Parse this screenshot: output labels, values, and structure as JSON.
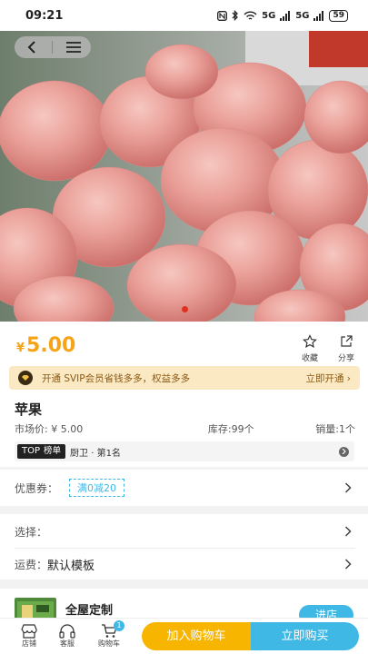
{
  "status_bar": {
    "time": "09:21",
    "network": "5G",
    "battery": "59"
  },
  "hero": {
    "alt": "苹果商品图",
    "active_slide": 1
  },
  "product": {
    "currency": "¥",
    "price": "5.00",
    "favorite_label": "收藏",
    "share_label": "分享",
    "name": "苹果",
    "market_price": "市场价: ¥ 5.00",
    "stock": "库存:99个",
    "sales": "销量:1个"
  },
  "svip": {
    "text": "开通 SVIP会员省钱多多，权益多多",
    "link": "立即开通 ›"
  },
  "ranking": {
    "tag_top": "TOP",
    "tag_label": "榜单",
    "text": "厨卫 · 第1名"
  },
  "coupon": {
    "label": "优惠券：",
    "tag": "满0减20"
  },
  "options": {
    "select_label": "选择：",
    "shipping_label": "运费：",
    "shipping_value": "默认模板"
  },
  "shop": {
    "name": "全屋定制",
    "enter_label": "进店"
  },
  "bottom_bar": {
    "store_label": "店铺",
    "service_label": "客服",
    "cart_label": "购物车",
    "cart_count": "1",
    "add_to_cart": "加入购物车",
    "buy_now": "立即购买"
  },
  "colors": {
    "accent": "#f5a417",
    "primary": "#3fb8e6",
    "cart_button": "#f7b500",
    "page_dot": "#e0301e"
  },
  "icons": [
    "back-icon",
    "menu-icon",
    "star-icon",
    "share-icon",
    "diamond-icon",
    "chevron-right-icon",
    "store-icon",
    "headset-icon",
    "cart-icon"
  ]
}
